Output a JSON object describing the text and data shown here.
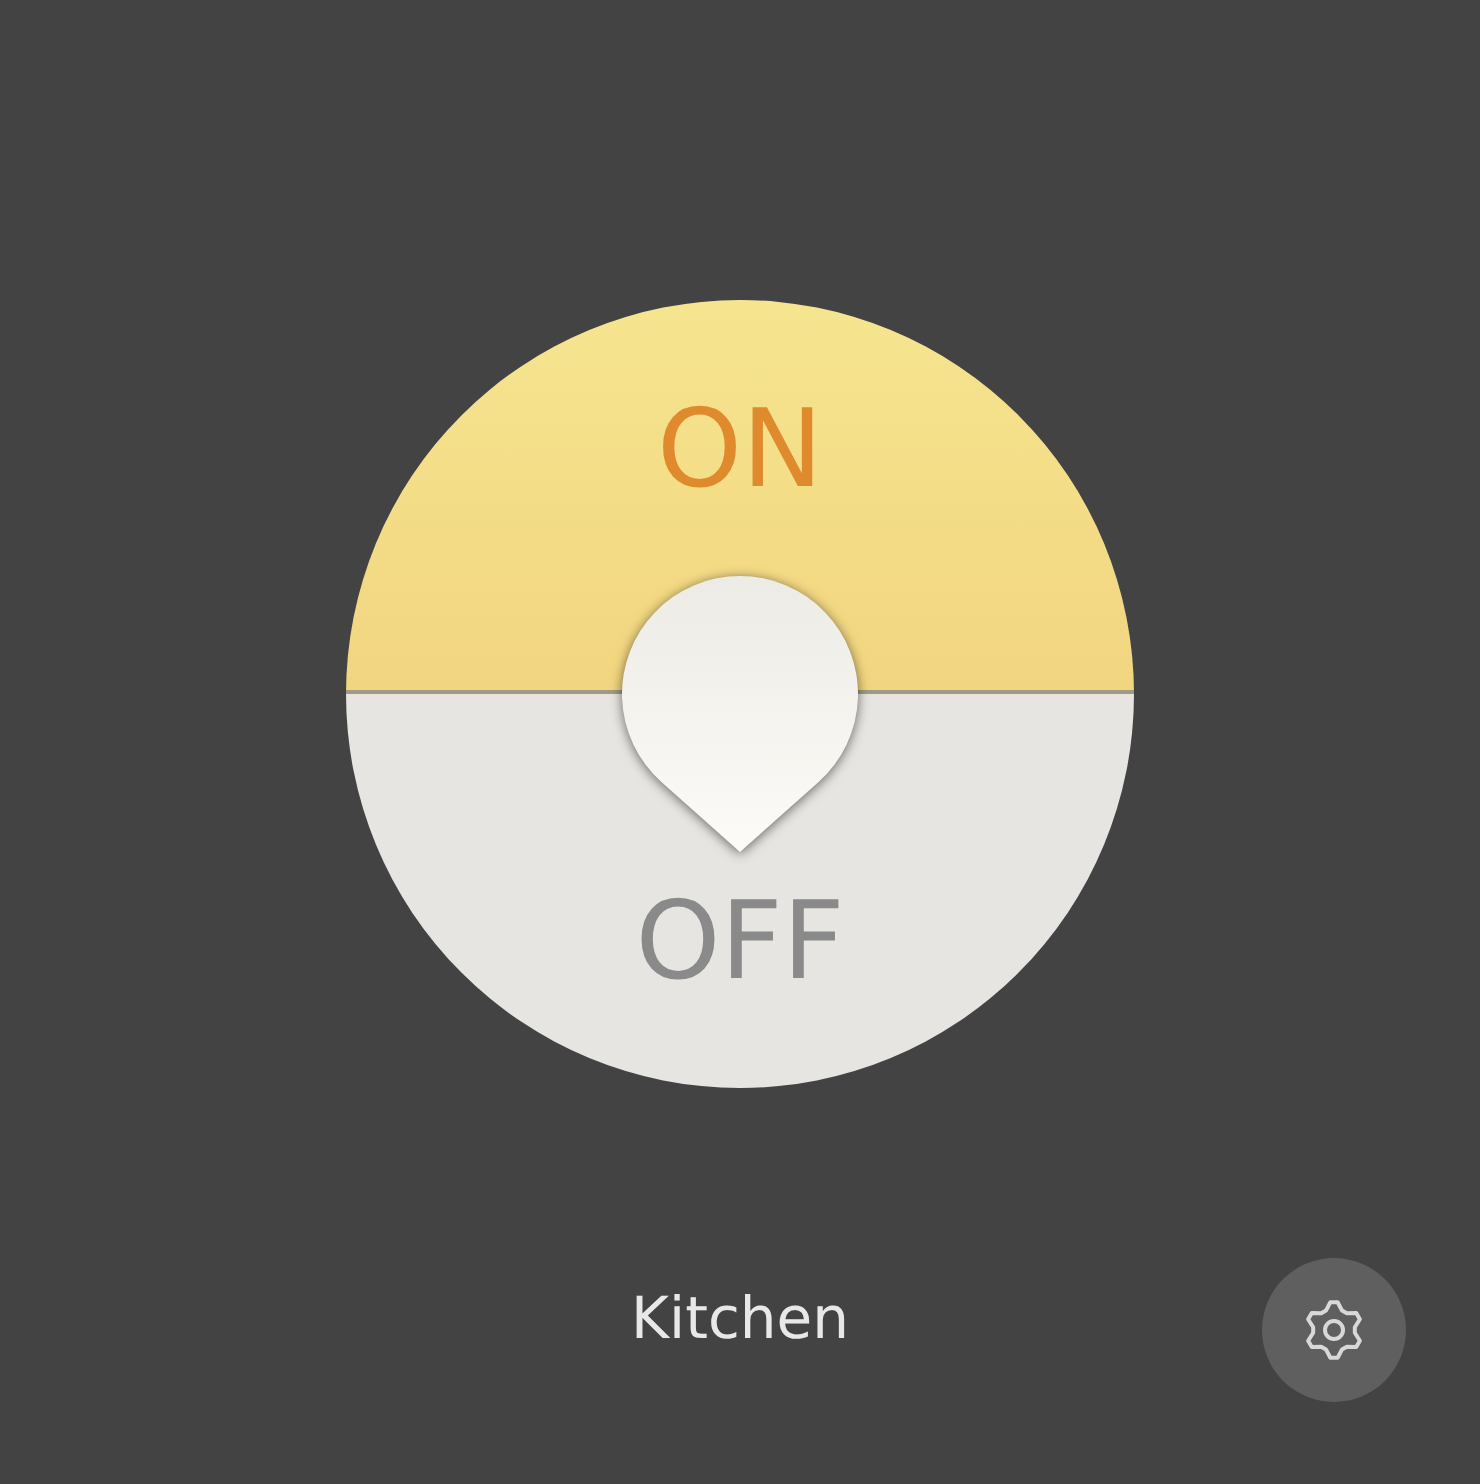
{
  "switch": {
    "on_label": "ON",
    "off_label": "OFF",
    "on": false
  },
  "room": "Kitchen"
}
